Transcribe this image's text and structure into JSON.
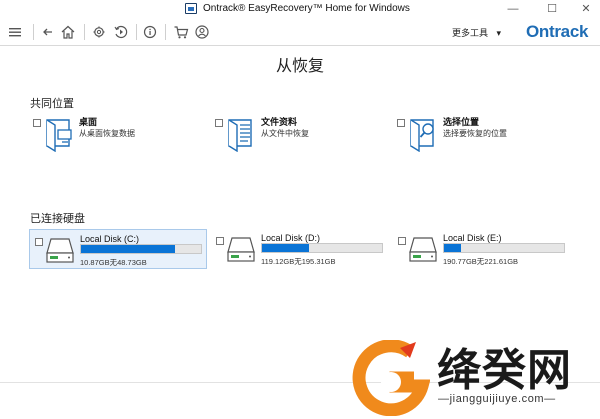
{
  "window": {
    "title": "Ontrack® EasyRecovery™ Home for Windows",
    "minimize": "—",
    "maximize": "☐",
    "close": "✕"
  },
  "toolbar": {
    "more_tools": "更多工具",
    "more_tools_arrow": "▾",
    "brand": "Ontrack",
    "brand_color": "#1f6db5"
  },
  "page": {
    "title": "从恢复"
  },
  "common_locations": {
    "heading": "共同位置",
    "items": [
      {
        "name": "桌面",
        "desc": "从桌面恢复数据",
        "icon": "desktop-icon"
      },
      {
        "name": "文件资料",
        "desc": "从文件中恢复",
        "icon": "documents-icon"
      },
      {
        "name": "选择位置",
        "desc": "选择要恢复的位置",
        "icon": "folder-search-icon"
      }
    ]
  },
  "drives": {
    "heading": "已连接硬盘",
    "items": [
      {
        "name": "Local Disk (C:)",
        "size": "10.87GB无48.73GB",
        "used_fraction": 0.78,
        "selected": true
      },
      {
        "name": "Local Disk (D:)",
        "size": "119.12GB无195.31GB",
        "used_fraction": 0.39,
        "selected": false
      },
      {
        "name": "Local Disk (E:)",
        "size": "190.77GB无221.61GB",
        "used_fraction": 0.14,
        "selected": false
      }
    ],
    "bar_color": "#0a74d6"
  },
  "watermark": {
    "text": "绛癸网",
    "url": "—jiangguijiuye.com—"
  }
}
